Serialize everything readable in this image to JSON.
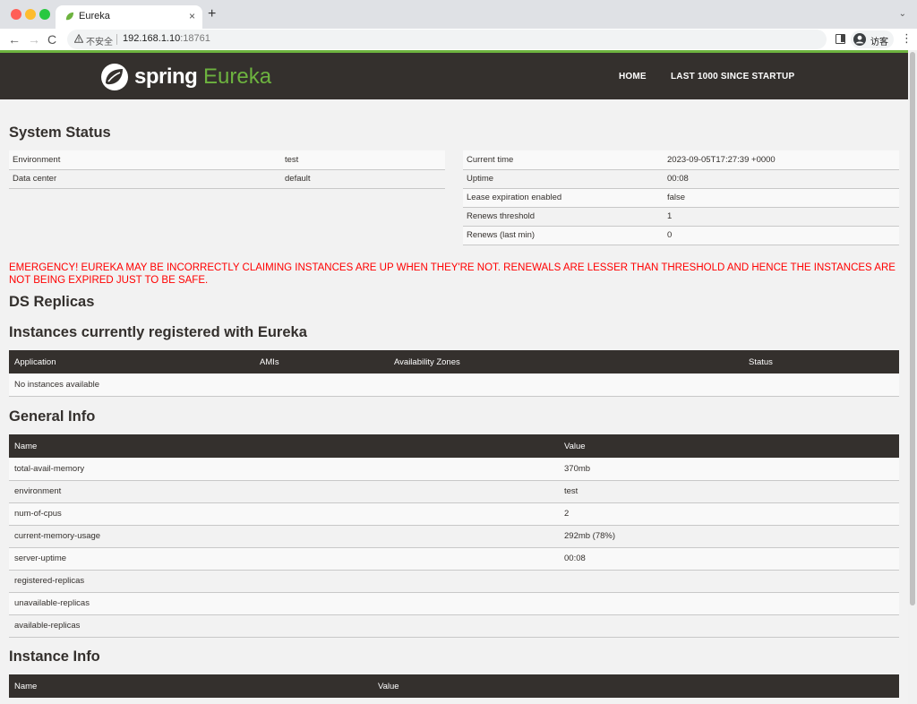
{
  "browser": {
    "tab_title": "Eureka",
    "tab_close": "×",
    "new_tab": "+",
    "tab_menu": "⌄",
    "back": "←",
    "forward": "→",
    "reload": "C",
    "security_label": "不安全",
    "url_host": "192.168.1.10",
    "url_port": ":18761",
    "profile_label": "访客",
    "menu": "⋮"
  },
  "navbar": {
    "brand_spring": "spring",
    "brand_eureka": "Eureka",
    "links": [
      "HOME",
      "LAST 1000 SINCE STARTUP"
    ],
    "accent_color": "#6db33f",
    "bar_color": "#34302d"
  },
  "system_status": {
    "heading": "System Status",
    "left": [
      {
        "key": "Environment",
        "value": "test"
      },
      {
        "key": "Data center",
        "value": "default"
      }
    ],
    "right": [
      {
        "key": "Current time",
        "value": "2023-09-05T17:27:39 +0000"
      },
      {
        "key": "Uptime",
        "value": "00:08"
      },
      {
        "key": "Lease expiration enabled",
        "value": "false"
      },
      {
        "key": "Renews threshold",
        "value": "1"
      },
      {
        "key": "Renews (last min)",
        "value": "0"
      }
    ]
  },
  "emergency": "EMERGENCY! EUREKA MAY BE INCORRECTLY CLAIMING INSTANCES ARE UP WHEN THEY'RE NOT. RENEWALS ARE LESSER THAN THRESHOLD AND HENCE THE INSTANCES ARE NOT BEING EXPIRED JUST TO BE SAFE.",
  "ds_replicas": {
    "heading": "DS Replicas"
  },
  "instances": {
    "heading": "Instances currently registered with Eureka",
    "columns": [
      "Application",
      "AMIs",
      "Availability Zones",
      "Status"
    ],
    "empty_message": "No instances available"
  },
  "general_info": {
    "heading": "General Info",
    "columns": [
      "Name",
      "Value"
    ],
    "rows": [
      {
        "name": "total-avail-memory",
        "value": "370mb"
      },
      {
        "name": "environment",
        "value": "test"
      },
      {
        "name": "num-of-cpus",
        "value": "2"
      },
      {
        "name": "current-memory-usage",
        "value": "292mb (78%)"
      },
      {
        "name": "server-uptime",
        "value": "00:08"
      },
      {
        "name": "registered-replicas",
        "value": ""
      },
      {
        "name": "unavailable-replicas",
        "value": ""
      },
      {
        "name": "available-replicas",
        "value": ""
      }
    ]
  },
  "instance_info": {
    "heading": "Instance Info",
    "columns": [
      "Name",
      "Value"
    ]
  }
}
